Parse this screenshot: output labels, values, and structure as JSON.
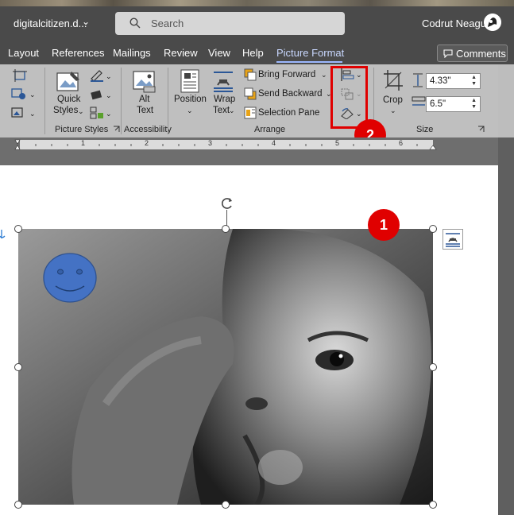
{
  "titlebar": {
    "doc_title": "digitalcitizen.d...",
    "search_placeholder": "Search",
    "user_name": "Codrut Neagu"
  },
  "tabs": [
    "Layout",
    "References",
    "Mailings",
    "Review",
    "View",
    "Help",
    "Picture Format"
  ],
  "active_tab": "Picture Format",
  "comments_label": "Comments",
  "ribbon": {
    "picture_styles": {
      "quick_styles_line1": "Quick",
      "quick_styles_line2": "Styles",
      "group_label": "Picture Styles"
    },
    "accessibility": {
      "alt_text_line1": "Alt",
      "alt_text_line2": "Text",
      "group_label": "Accessibility"
    },
    "arrange": {
      "position_label": "Position",
      "wrap_text_line1": "Wrap",
      "wrap_text_line2": "Text",
      "bring_forward": "Bring Forward",
      "send_backward": "Send Backward",
      "selection_pane": "Selection Pane",
      "group_label": "Arrange"
    },
    "size": {
      "crop_label": "Crop",
      "height": "4.33\"",
      "width": "6.5\"",
      "group_label": "Size"
    }
  },
  "ruler_numbers": [
    "1",
    "2",
    "3",
    "4",
    "5",
    "6"
  ],
  "callouts": {
    "badge_1": "1",
    "badge_2": "2"
  },
  "colors": {
    "highlight": "#e00000",
    "active_tab": "#c9d8ff",
    "smiley": "#4472c4"
  }
}
